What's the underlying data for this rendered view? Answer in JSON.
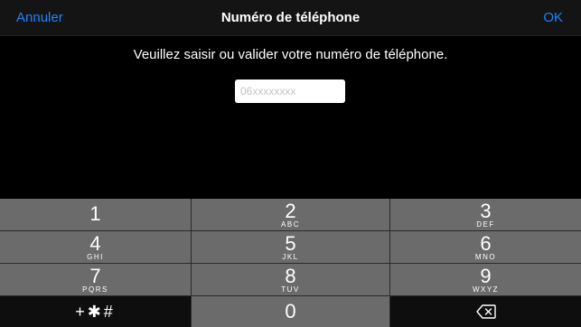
{
  "navbar": {
    "cancel_label": "Annuler",
    "title": "Numéro de téléphone",
    "ok_label": "OK"
  },
  "main": {
    "instruction": "Veuillez saisir ou valider votre numéro de téléphone.",
    "phone_input": {
      "value": "",
      "placeholder": "06xxxxxxxx"
    }
  },
  "keypad": {
    "keys": [
      {
        "digit": "1",
        "letters": ""
      },
      {
        "digit": "2",
        "letters": "ABC"
      },
      {
        "digit": "3",
        "letters": "DEF"
      },
      {
        "digit": "4",
        "letters": "GHI"
      },
      {
        "digit": "5",
        "letters": "JKL"
      },
      {
        "digit": "6",
        "letters": "MNO"
      },
      {
        "digit": "7",
        "letters": "PQRS"
      },
      {
        "digit": "8",
        "letters": "TUV"
      },
      {
        "digit": "9",
        "letters": "WXYZ"
      }
    ],
    "symbols_label": "+✱#",
    "zero_label": "0",
    "backspace_icon": "backspace-icon"
  },
  "colors": {
    "accent": "#1a84ff",
    "key_background": "#6b6b6b",
    "key_dark_background": "#0e0e0e",
    "navbar_background": "#141414",
    "background": "#000000"
  }
}
